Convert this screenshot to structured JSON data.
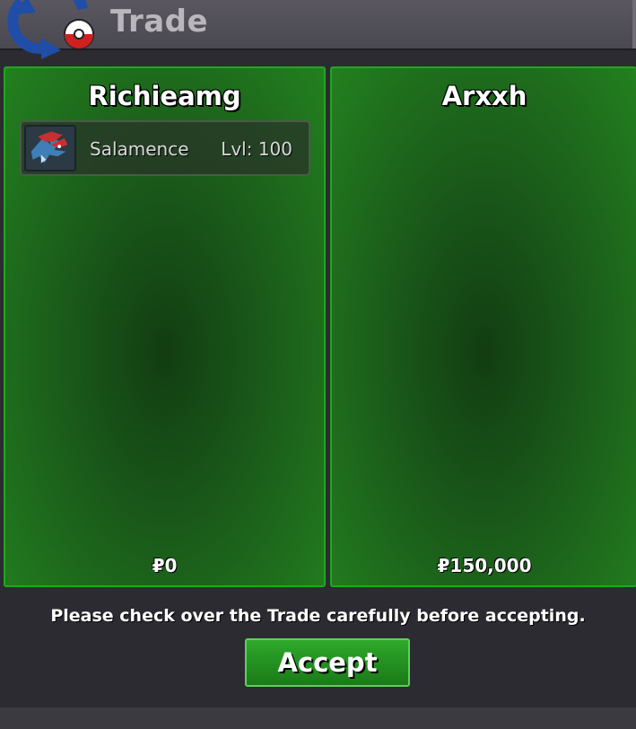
{
  "window": {
    "title": "Trade"
  },
  "left_panel": {
    "player_name": "Richieamg",
    "pokemon": [
      {
        "name": "Salamence",
        "level": "Lvl: 100",
        "icon": "salamence-sprite-icon"
      }
    ],
    "money": "₽0"
  },
  "right_panel": {
    "player_name": "Arxxh",
    "money": "₽150,000"
  },
  "footer": {
    "message": "Please check over the Trade carefully before accepting.",
    "accept_label": "Accept"
  },
  "colors": {
    "panel_green": "#1fa81f",
    "panel_bg": "#1a5a1a",
    "button_green": "#2fa92b",
    "window_bg": "#2c2b31"
  }
}
